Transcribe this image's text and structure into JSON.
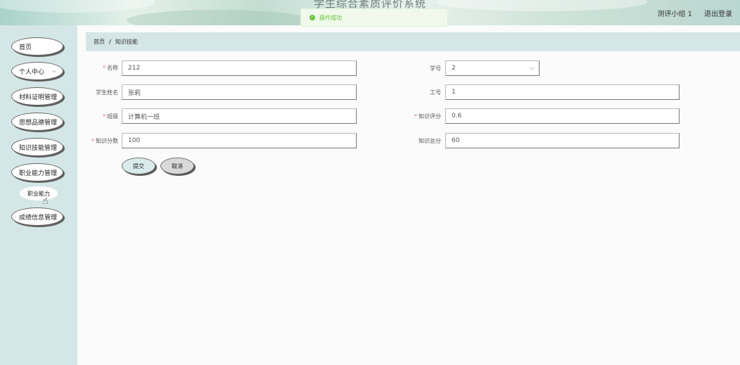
{
  "header": {
    "app_title": "学生综合素质评价系统",
    "user": "测评小组 1",
    "logout": "退出登录"
  },
  "toast": {
    "message": "操作成功"
  },
  "sidebar": {
    "items": [
      {
        "label": "首页"
      },
      {
        "label": "个人中心"
      },
      {
        "label": "材料证明管理"
      },
      {
        "label": "思想品德管理"
      },
      {
        "label": "知识技能管理"
      },
      {
        "label": "职业能力管理"
      },
      {
        "label": "成绩信息管理"
      }
    ],
    "subitem": "职业能力"
  },
  "breadcrumb": {
    "home": "首页",
    "separator": "/",
    "current": "知识技能"
  },
  "form": {
    "name_label": "名称",
    "name_value": "212",
    "xuehao_label": "学号",
    "xuehao_value": "2",
    "student_label": "学生姓名",
    "student_value": "张莉",
    "gonghao_label": "工号",
    "gonghao_value": "1",
    "class_label": "班级",
    "class_value": "计算机一班",
    "rate_label": "知识评分",
    "rate_value": "0.6",
    "score_label": "知识分数",
    "score_value": "100",
    "total_label": "知识总分",
    "total_value": "60",
    "submit": "提交",
    "cancel": "取消",
    "required_mark": "*"
  }
}
